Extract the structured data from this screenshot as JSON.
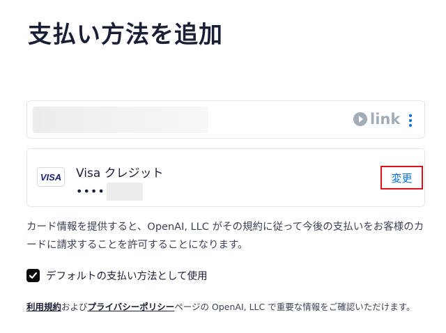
{
  "page": {
    "title": "支払い方法を追加"
  },
  "link_card": {
    "logo_text": "link",
    "menu_icon": "more-vertical-icon"
  },
  "payment_card": {
    "brand_logo": "VISA",
    "name": "Visa クレジット",
    "masked_number": "••••",
    "change_label": "変更"
  },
  "consent": {
    "text": "カード情報を提供すると、OpenAI, LLC がその規約に従って今後の支払いをお客様のカードに請求することを許可することになります。"
  },
  "default_option": {
    "checked": true,
    "label": "デフォルトの支払い方法として使用"
  },
  "terms": {
    "terms_link": "利用規約",
    "connector": "および",
    "privacy_link": "プライバシーポリシー",
    "suffix": "ページの OpenAI, LLC で重要な情報をご確認いただけます。"
  },
  "colors": {
    "accent": "#0570de",
    "highlight_border": "#e0101b",
    "link_logo": "#a3acb9"
  }
}
